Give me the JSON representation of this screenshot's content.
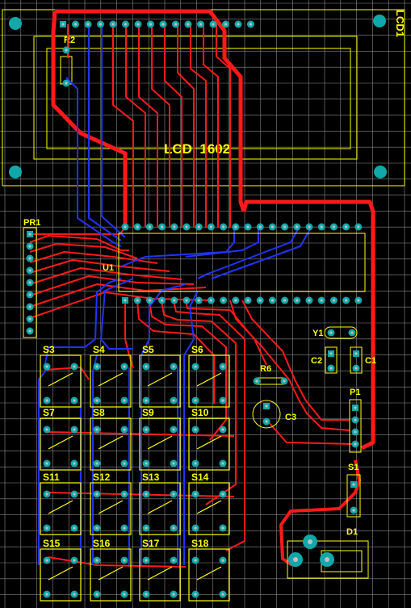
{
  "colors": {
    "background": "#000000",
    "grid": "#8a8a8a",
    "silkscreen": "#ffff00",
    "top_trace": "#ff1a1a",
    "bottom_trace": "#2233ff",
    "pad": "#10a8a8",
    "hole": "#bfbfbf"
  },
  "labels": {
    "lcd_title": "LCD  1602",
    "lcd_ref": "LCD1",
    "r2": "R2",
    "pr1": "PR1",
    "u1": "U1",
    "y1": "Y1",
    "c1": "C1",
    "c2": "C2",
    "r6": "R6",
    "c3": "C3",
    "p1": "P1",
    "s1": "S1",
    "d1": "D1",
    "switches": [
      "S3",
      "S4",
      "S5",
      "S6",
      "S7",
      "S8",
      "S9",
      "S10",
      "S11",
      "S12",
      "S13",
      "S14",
      "S15",
      "S16",
      "S17",
      "S18"
    ]
  }
}
